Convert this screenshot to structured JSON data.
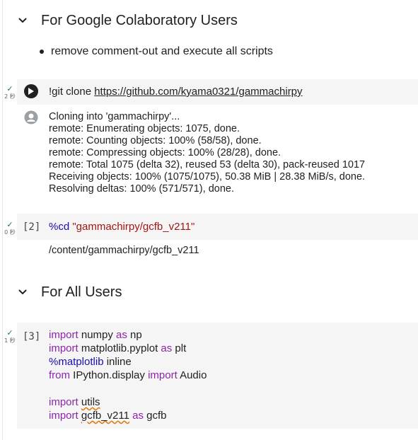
{
  "sections": {
    "google": {
      "title": "For Google Colaboratory Users"
    },
    "all": {
      "title": "For All Users"
    }
  },
  "bullet": {
    "text": "remove comment-out and execute all scripts"
  },
  "cells": {
    "c1": {
      "status_time": "2 秒",
      "code_cmd": "!git clone ",
      "code_url": "https://github.com/kyama0321/gammachirpy",
      "output_lines": [
        "Cloning into 'gammachirpy'...",
        "remote: Enumerating objects: 1075, done.",
        "remote: Counting objects: 100% (58/58), done.",
        "remote: Compressing objects: 100% (28/28), done.",
        "remote: Total 1075 (delta 32), reused 53 (delta 30), pack-reused 1017",
        "Receiving objects: 100% (1075/1075), 50.38 MiB | 28.38 MiB/s, done.",
        "Resolving deltas: 100% (571/571), done."
      ]
    },
    "c2": {
      "status_time": "0 秒",
      "exec_count": "[2]",
      "magic": "%cd",
      "arg": "\"gammachirpy/gcfb_v211\"",
      "output": "/content/gammachirpy/gcfb_v211"
    },
    "c3": {
      "status_time": "1 秒",
      "exec_count": "[3]",
      "l1_kw": "import",
      "l1_mod": " numpy ",
      "l1_as": "as",
      "l1_alias": " np",
      "l2_kw": "import",
      "l2_mod": " matplotlib.pyplot ",
      "l2_as": "as",
      "l2_alias": " plt",
      "l3_magic": "%matplotlib",
      "l3_arg": " inline",
      "l4_kw": "from",
      "l4_mod": " IPython.display ",
      "l4_kw2": "import",
      "l4_name": " Audio",
      "l6_kw": "import",
      "l6_mod": "utils",
      "l7_kw": "import",
      "l7_mod": "gcfb_v211",
      "l7_as": "as",
      "l7_alias": " gcfb"
    }
  },
  "colors": {
    "keyword": "#8e24aa",
    "magic": "#1a0dab",
    "string": "#a31515",
    "check": "#188038"
  }
}
